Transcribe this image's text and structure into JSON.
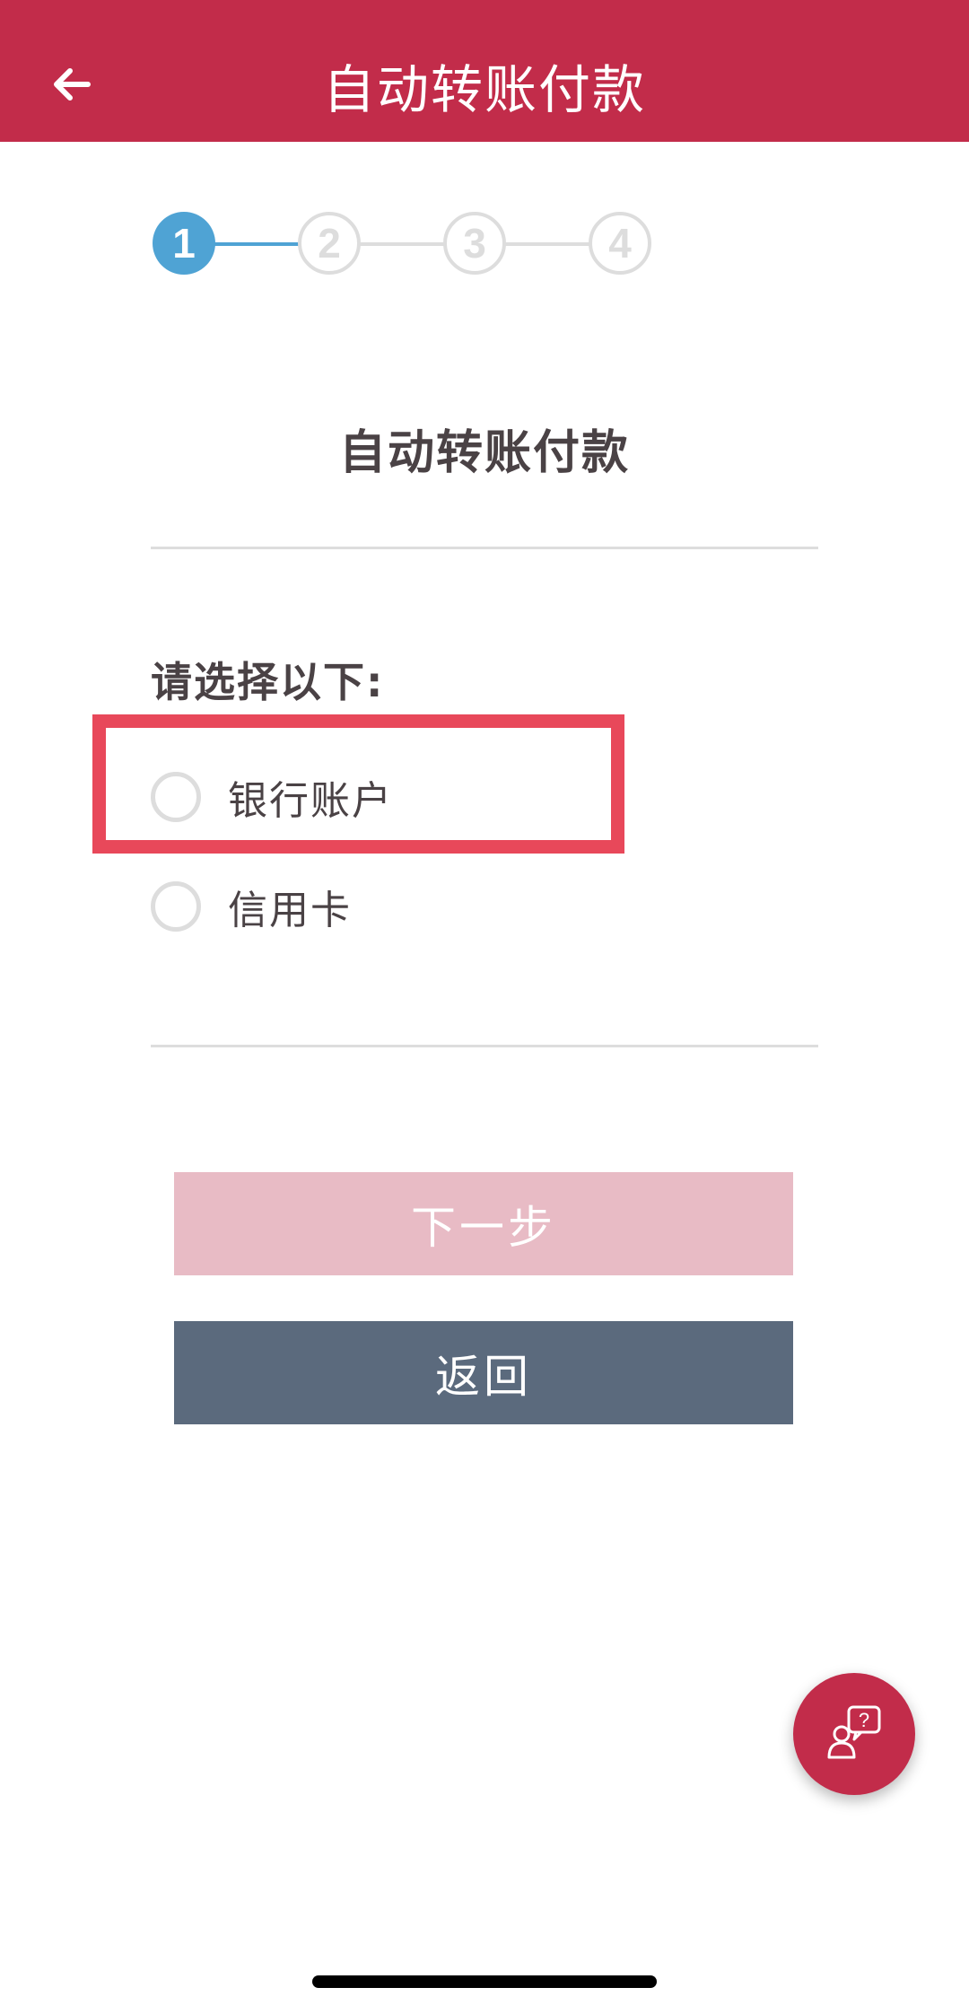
{
  "header": {
    "title": "自动转账付款",
    "back_icon": "arrow-left-icon",
    "background": "#c22c4a"
  },
  "stepper": {
    "steps": [
      "1",
      "2",
      "3",
      "4"
    ],
    "current_step": 1,
    "active_color": "#4fa3d4",
    "inactive_color": "#dddddd"
  },
  "main": {
    "section_title": "自动转账付款",
    "prompt": "请选择以下:",
    "options": [
      {
        "label": "银行账户",
        "selected": false
      },
      {
        "label": "信用卡",
        "selected": false
      }
    ],
    "highlight_color": "#e8485a"
  },
  "buttons": {
    "next_label": "下一步",
    "back_label": "返回",
    "next_color": "#e8bbc5",
    "back_color": "#5b6a7d"
  },
  "fab": {
    "icon": "customer-support-icon"
  }
}
